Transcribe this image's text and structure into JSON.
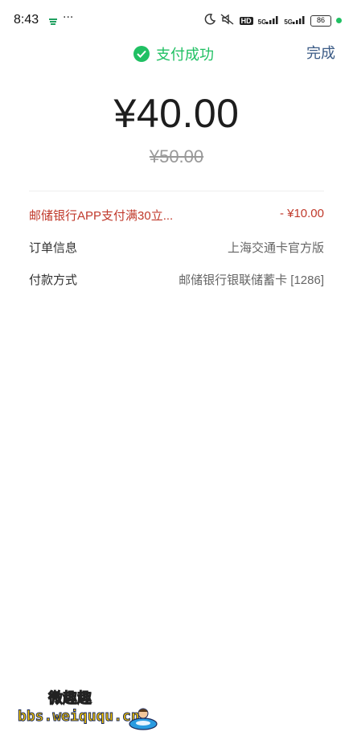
{
  "status_bar": {
    "time": "8:43",
    "battery": "86",
    "network_1": "5G",
    "network_2": "5G",
    "hd": "HD"
  },
  "header": {
    "status_text": "支付成功",
    "done_label": "完成",
    "success_color": "#20c063"
  },
  "payment": {
    "amount": "¥40.00",
    "original_amount": "¥50.00"
  },
  "details": [
    {
      "label": "邮储银行APP支付满30立...",
      "value": "- ¥10.00",
      "type": "discount"
    },
    {
      "label": "订单信息",
      "value": "上海交通卡官方版",
      "type": "normal"
    },
    {
      "label": "付款方式",
      "value": "邮储银行银联储蓄卡 [1286]",
      "type": "normal"
    }
  ],
  "watermark": {
    "title": "微趣趣",
    "url": "bbs.weiququ.cn"
  }
}
